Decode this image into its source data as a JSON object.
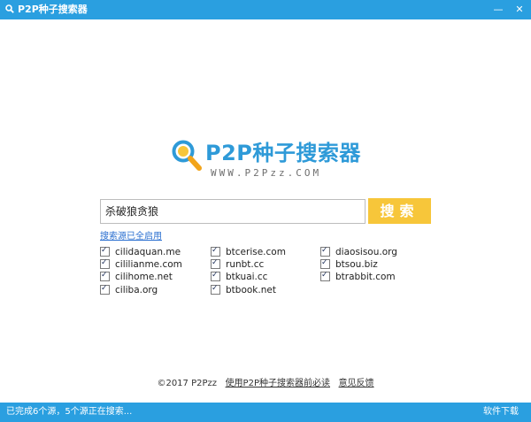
{
  "window": {
    "title": "P2P种子搜索器",
    "minimize": "—",
    "close": "✕"
  },
  "logo": {
    "brand": "P2P种子搜索器",
    "url": "WWW.P2Pzz.COM"
  },
  "search": {
    "query": "杀破狼贪狼",
    "button": "搜索"
  },
  "sources_link": "搜索源已全启用",
  "sources": [
    [
      {
        "label": "cilidaquan.me",
        "checked": true
      },
      {
        "label": "cililianme.com",
        "checked": true
      },
      {
        "label": "cilihome.net",
        "checked": true
      },
      {
        "label": "ciliba.org",
        "checked": true
      }
    ],
    [
      {
        "label": "btcerise.com",
        "checked": true
      },
      {
        "label": "runbt.cc",
        "checked": true
      },
      {
        "label": "btkuai.cc",
        "checked": true
      },
      {
        "label": "btbook.net",
        "checked": true
      }
    ],
    [
      {
        "label": "diaosisou.org",
        "checked": true
      },
      {
        "label": "btsou.biz",
        "checked": true
      },
      {
        "label": "btrabbit.com",
        "checked": true
      }
    ]
  ],
  "footer": {
    "copyright": "©2017  P2Pzz",
    "notice": "使用P2P种子搜索器前必读",
    "feedback": "意见反馈"
  },
  "statusbar": {
    "status": "已完成6个源，5个源正在搜索...",
    "download": "软件下载"
  },
  "colors": {
    "accent": "#2a9fe0",
    "search_button": "#f7c63a",
    "link": "#2a6fd0"
  }
}
